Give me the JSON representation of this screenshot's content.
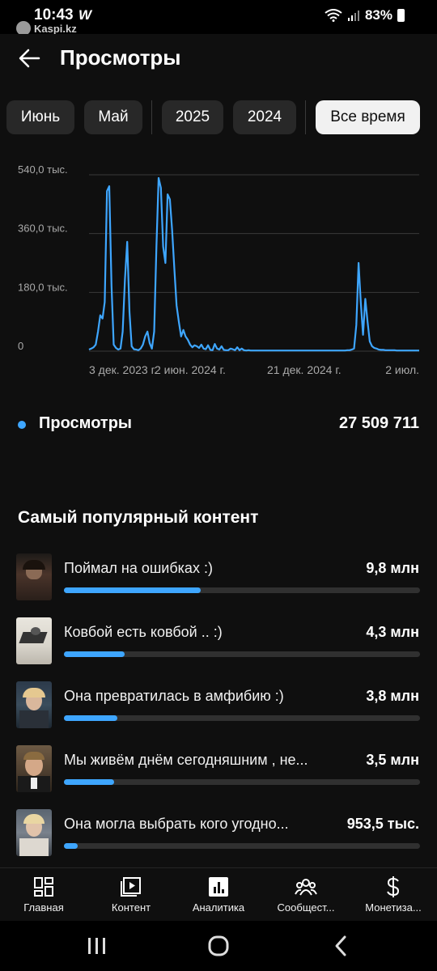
{
  "status_bar": {
    "time": "10:43",
    "w_label": "W",
    "brand": "Kaspi.kz",
    "battery": "83%"
  },
  "header": {
    "title": "Просмотры"
  },
  "filters": [
    {
      "label": "Июнь",
      "active": false
    },
    {
      "label": "Май",
      "active": false
    },
    {
      "label": "2025",
      "active": false
    },
    {
      "label": "2024",
      "active": false
    },
    {
      "label": "Все время",
      "active": true
    }
  ],
  "chart_data": {
    "type": "line",
    "series": [
      {
        "values": [
          5,
          8,
          12,
          20,
          60,
          110,
          100,
          150,
          490,
          505,
          200,
          20,
          10,
          5,
          8,
          60,
          220,
          335,
          120,
          15,
          6,
          5,
          3,
          8,
          20,
          45,
          60,
          25,
          8,
          60,
          320,
          530,
          500,
          320,
          270,
          480,
          465,
          370,
          250,
          140,
          90,
          45,
          65,
          45,
          35,
          20,
          12,
          18,
          15,
          10,
          20,
          8,
          6,
          18,
          4,
          3,
          22,
          8,
          5,
          15,
          4,
          3,
          3,
          8,
          6,
          3,
          12,
          3,
          8,
          3,
          2,
          3,
          2,
          2,
          2,
          2,
          2,
          2,
          2,
          2,
          2,
          2,
          2,
          2,
          2,
          2,
          2,
          2,
          2,
          2,
          2,
          2,
          2,
          2,
          2,
          2,
          2,
          2,
          2,
          2,
          2,
          2,
          2,
          2,
          2,
          2,
          2,
          2,
          2,
          2,
          2,
          2,
          2,
          2,
          2,
          3,
          3,
          5,
          8,
          80,
          270,
          150,
          50,
          160,
          90,
          30,
          15,
          10,
          8,
          5,
          4,
          4,
          3,
          3,
          3,
          3,
          3,
          2,
          2,
          2,
          2,
          2,
          2,
          2,
          2,
          2,
          2,
          2
        ]
      }
    ],
    "x_tick_labels": [
      "3 дек. 2023 г.",
      "2 июн. 2024 г.",
      "21 дек. 2024 г.",
      "2 июл."
    ],
    "y_tick_labels": [
      "540,0 тыс.",
      "360,0 тыс.",
      "180,0 тыс.",
      "0"
    ],
    "y_unit": "thousands",
    "ylim": [
      0,
      540
    ],
    "grid": true,
    "color": "#3ea6ff"
  },
  "legend": {
    "name": "Просмотры",
    "total": "27 509 711"
  },
  "popular": {
    "title": "Самый популярный контент",
    "items": [
      {
        "title": "Поймал на ошибках :)",
        "value": "9,8 млн",
        "share": 0.385
      },
      {
        "title": "Ковбой есть ковбой .. :)",
        "value": "4,3 млн",
        "share": 0.17
      },
      {
        "title": "Она превратилась в амфибию :)",
        "value": "3,8 млн",
        "share": 0.15
      },
      {
        "title": "Мы живём днём сегодняшним , не...",
        "value": "3,5 млн",
        "share": 0.14
      },
      {
        "title": "Она могла выбрать кого угодно...",
        "value": "953,5 тыс.",
        "share": 0.038
      }
    ]
  },
  "bottom_nav": [
    {
      "label": "Главная",
      "icon": "dashboard-icon"
    },
    {
      "label": "Контент",
      "icon": "content-icon"
    },
    {
      "label": "Аналитика",
      "icon": "analytics-icon"
    },
    {
      "label": "Сообщест...",
      "icon": "community-icon"
    },
    {
      "label": "Монетиза...",
      "icon": "dollar-icon"
    }
  ]
}
